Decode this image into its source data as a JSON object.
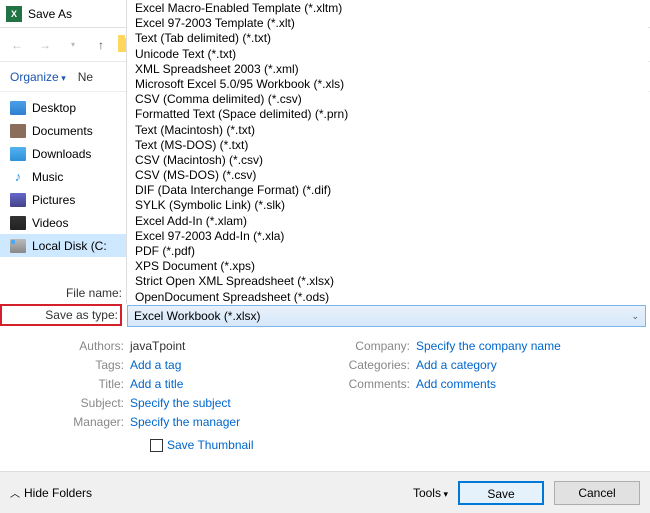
{
  "window": {
    "title": "Save As"
  },
  "toolbar": {
    "organize": "Organize",
    "new": "Ne"
  },
  "sidebar": {
    "items": [
      {
        "label": "Desktop"
      },
      {
        "label": "Documents"
      },
      {
        "label": "Downloads"
      },
      {
        "label": "Music"
      },
      {
        "label": "Pictures"
      },
      {
        "label": "Videos"
      },
      {
        "label": "Local Disk (C:"
      }
    ]
  },
  "filetype_options": [
    "Excel Macro-Enabled Template (*.xltm)",
    "Excel 97-2003 Template (*.xlt)",
    "Text (Tab delimited) (*.txt)",
    "Unicode Text (*.txt)",
    "XML Spreadsheet 2003 (*.xml)",
    "Microsoft Excel 5.0/95 Workbook (*.xls)",
    "CSV (Comma delimited) (*.csv)",
    "Formatted Text (Space delimited) (*.prn)",
    "Text (Macintosh) (*.txt)",
    "Text (MS-DOS) (*.txt)",
    "CSV (Macintosh) (*.csv)",
    "CSV (MS-DOS) (*.csv)",
    "DIF (Data Interchange Format) (*.dif)",
    "SYLK (Symbolic Link) (*.slk)",
    "Excel Add-In (*.xlam)",
    "Excel 97-2003 Add-In (*.xla)",
    "PDF (*.pdf)",
    "XPS Document (*.xps)",
    "Strict Open XML Spreadsheet (*.xlsx)",
    "OpenDocument Spreadsheet (*.ods)"
  ],
  "labels": {
    "filename": "File name:",
    "saveastype": "Save as type:"
  },
  "selected_type": "Excel Workbook (*.xlsx)",
  "meta": {
    "authors_label": "Authors:",
    "authors": "javaTpoint",
    "tags_label": "Tags:",
    "tags": "Add a tag",
    "title_label": "Title:",
    "title": "Add a title",
    "subject_label": "Subject:",
    "subject": "Specify the subject",
    "manager_label": "Manager:",
    "manager": "Specify the manager",
    "company_label": "Company:",
    "company": "Specify the company name",
    "categories_label": "Categories:",
    "categories": "Add a category",
    "comments_label": "Comments:",
    "comments": "Add comments"
  },
  "thumbnail_label": "Save Thumbnail",
  "footer": {
    "hide": "Hide Folders",
    "tools": "Tools",
    "save": "Save",
    "cancel": "Cancel"
  }
}
